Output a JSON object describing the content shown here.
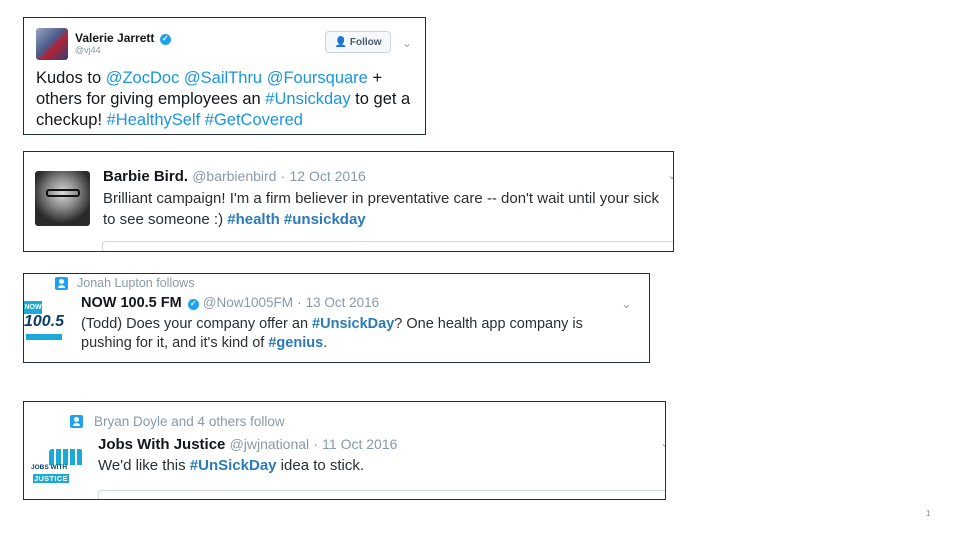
{
  "tweets": [
    {
      "name": "Valerie Jarrett",
      "handle": "@vj44",
      "follow_label": "Follow",
      "text": [
        {
          "t": "Kudos to ",
          "c": ""
        },
        {
          "t": "@ZocDoc",
          "c": "link"
        },
        {
          "t": " ",
          "c": ""
        },
        {
          "t": "@SailThru",
          "c": "link"
        },
        {
          "t": " ",
          "c": ""
        },
        {
          "t": "@Foursquare",
          "c": "link"
        },
        {
          "t": " + others for giving employees an ",
          "c": ""
        },
        {
          "t": "#Unsickday",
          "c": "link"
        },
        {
          "t": " to get a checkup! ",
          "c": ""
        },
        {
          "t": "#HealthySelf",
          "c": "link"
        },
        {
          "t": " ",
          "c": ""
        },
        {
          "t": "#GetCovered",
          "c": "link"
        }
      ]
    },
    {
      "name": "Barbie Bird.",
      "handle": "@barbienbird",
      "date": "12 Oct 2016",
      "text": [
        {
          "t": "Brilliant campaign! I'm a firm believer in preventative care -- don't wait until your sick to see someone :) ",
          "c": ""
        },
        {
          "t": "#health",
          "c": "tag-strong"
        },
        {
          "t": " ",
          "c": ""
        },
        {
          "t": "#unsickday",
          "c": "tag-strong"
        }
      ]
    },
    {
      "context": "Jonah Lupton follows",
      "name": "NOW 100.5 FM",
      "handle": "@Now1005FM",
      "date": "13 Oct 2016",
      "logo_top": "NOW",
      "logo_num": "100.5",
      "text": [
        {
          "t": "(Todd) Does your company offer an ",
          "c": ""
        },
        {
          "t": "#UnsickDay",
          "c": "tag-strong"
        },
        {
          "t": "? One health app company is pushing for it, and it's kind of ",
          "c": ""
        },
        {
          "t": "#genius",
          "c": "tag-strong"
        },
        {
          "t": ".",
          "c": ""
        }
      ]
    },
    {
      "context": "Bryan Doyle and 4 others follow",
      "name": "Jobs With Justice",
      "handle": "@jwjnational",
      "date": "11 Oct 2016",
      "logo_line1": "JOBS WITH",
      "logo_line2": "JUSTICE",
      "text": [
        {
          "t": "We'd like this ",
          "c": ""
        },
        {
          "t": "#UnSickDay",
          "c": "tag-strong"
        },
        {
          "t": " idea to stick.",
          "c": ""
        }
      ]
    }
  ],
  "dot": "·",
  "slide_number": "1",
  "colors": {
    "link": "#1b95e0",
    "verified": "#1da1f2",
    "border": "#1f2d4a"
  }
}
